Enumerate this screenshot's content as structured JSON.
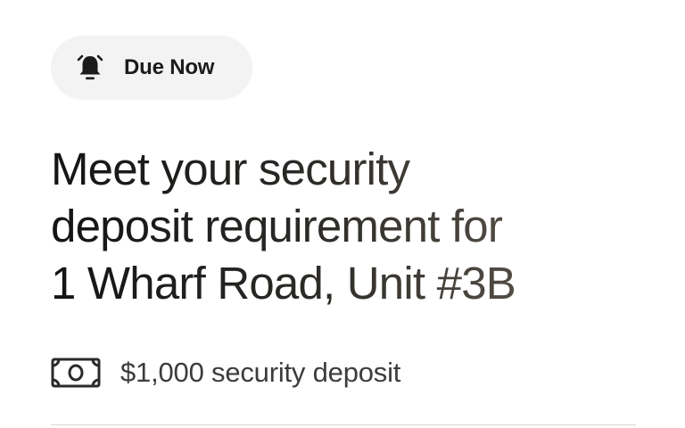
{
  "badge": {
    "icon": "alarm-bell-icon",
    "label": "Due Now"
  },
  "headline": {
    "line1": "Meet your security",
    "line2": "deposit requirement for",
    "line3": "1 Wharf Road, Unit #3B"
  },
  "deposit": {
    "icon": "money-bill-icon",
    "text": "$1,000 security deposit"
  },
  "colors": {
    "badge_bg": "#f3f3f3",
    "text_dark": "#1a1a1a",
    "text_muted": "#3c3c3c",
    "divider": "#d7d7d7"
  }
}
